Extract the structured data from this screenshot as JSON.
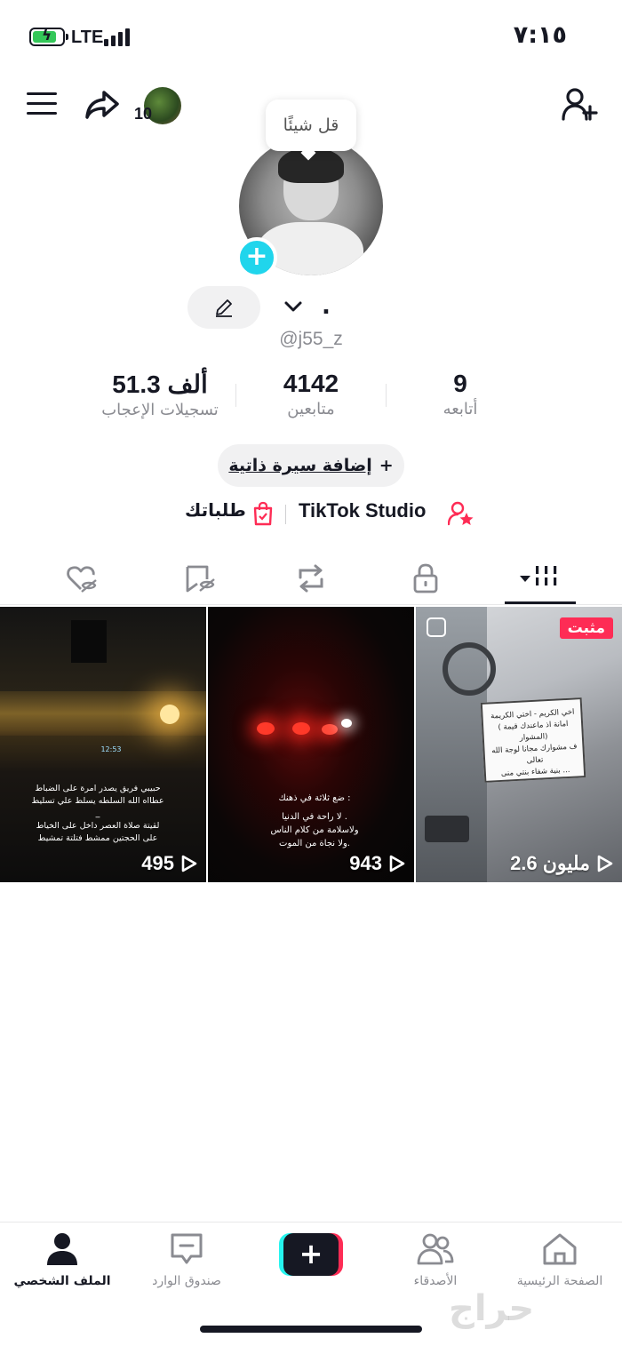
{
  "status_bar": {
    "network": "LTE",
    "time": "٧:١٥"
  },
  "header": {
    "mini_avatar_count": "10"
  },
  "profile": {
    "bubble_text": "قل شيئًا",
    "display_name": ".",
    "username": "@j55_z"
  },
  "stats": [
    {
      "value": "9",
      "label": "أتابعه"
    },
    {
      "value": "4142",
      "label": "متابعين"
    },
    {
      "value": "51.3 ألف",
      "label": "تسجيلات الإعجاب"
    }
  ],
  "bio_button": {
    "plus": "+",
    "label": "إضافة سيرة ذاتية"
  },
  "links": {
    "studio": "TikTok Studio",
    "orders": "طلباتك"
  },
  "tabs": [
    "videos-grid",
    "private-lock",
    "reposts",
    "favorites",
    "liked"
  ],
  "videos": [
    {
      "views": "495",
      "caption_lines": [
        "حبيبي فريق يصدر امرة على الضباط",
        "عطااه الله السلطه يسلط علي تسليط",
        "_",
        "لقيتة صلاة العصر داخل على الخياط",
        "على الحجتين ممشط فتلتة تمشيط"
      ],
      "clock_text": "12:53"
    },
    {
      "views": "943",
      "caption_lines": [
        "ضع ثلاثة في ذهنك :",
        "لا راحة في الدنيا .",
        "ولاسلامة من كلام الناس",
        "ولا نجاة من الموت."
      ]
    },
    {
      "views": "2.6 مليون",
      "pinned": "مثبت",
      "caption_lines": [
        "اخي الكريم - اختي الكريمة",
        "( امانة اذ ماعندك قيمة المشوار)",
        "ف مشوارك مجانا لوجة الله تعالى",
        "بنية شفاء بنتي منى ..."
      ]
    }
  ],
  "bottom_nav": [
    {
      "label": "الصفحة الرئيسية",
      "icon": "home-icon"
    },
    {
      "label": "الأصدقاء",
      "icon": "friends-icon"
    },
    {
      "label": "+",
      "icon": "create-icon"
    },
    {
      "label": "صندوق الوارد",
      "icon": "inbox-icon"
    },
    {
      "label": "الملف الشخصي",
      "icon": "profile-icon"
    }
  ],
  "watermark": "حراج",
  "colors": {
    "accent": "#fe2c55",
    "cyan": "#20d5ec",
    "text": "#161823",
    "muted": "#8a8b91"
  }
}
